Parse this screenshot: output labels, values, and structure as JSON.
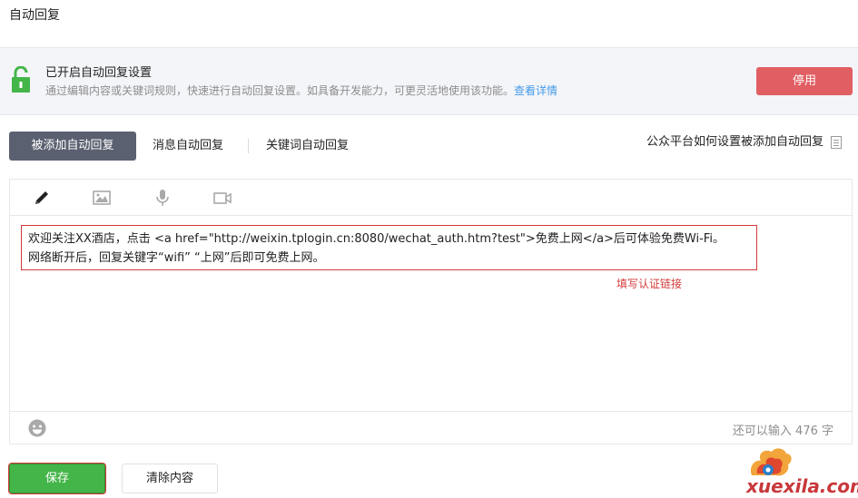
{
  "page": {
    "title": "自动回复"
  },
  "notice": {
    "title": "已开启自动回复设置",
    "description": "通过编辑内容或关键词规则，快速进行自动回复设置。如具备开发能力，可更灵活地使用该功能。",
    "link": "查看详情",
    "disable_button": "停用"
  },
  "tabs": [
    {
      "label": "被添加自动回复",
      "active": true
    },
    {
      "label": "消息自动回复",
      "active": false
    },
    {
      "label": "关键词自动回复",
      "active": false
    }
  ],
  "help_link": "公众平台如何设置被添加自动回复",
  "editor": {
    "tools": [
      "pencil-icon",
      "image-icon",
      "microphone-icon",
      "video-icon"
    ],
    "line1": "欢迎关注XX酒店，点击 <a href=\"http://weixin.tplogin.cn:8080/wechat_auth.htm?test\">免费上网</a>后可体验免费Wi-Fi。",
    "line2": "网络断开后，回复关键字“wifi” “上网”后即可免费上网。",
    "annotation": "填写认证链接",
    "counter": "还可以输入 476 字"
  },
  "buttons": {
    "save": "保存",
    "clear": "清除内容"
  },
  "watermark": {
    "text": "xuexila.com"
  },
  "colors": {
    "accent_green": "#44b549",
    "danger_red": "#e15f63",
    "link_blue": "#459ae9",
    "tab_active": "#5a6070"
  }
}
